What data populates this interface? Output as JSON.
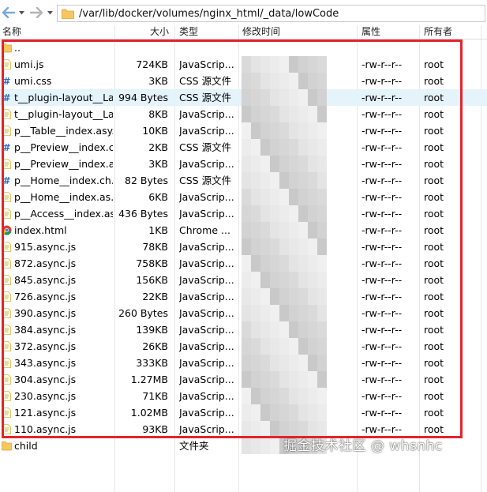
{
  "path_bar": {
    "path": "/var/lib/docker/volumes/nginx_html/_data/lowCode"
  },
  "columns": {
    "name": "名称",
    "size": "大小",
    "type": "类型",
    "modified": "修改时间",
    "perms": "属性",
    "owner": "所有者"
  },
  "files": [
    {
      "name": "..",
      "size": "",
      "type": "",
      "perms": "",
      "owner": "",
      "icon": "parent-folder-icon",
      "selected": false
    },
    {
      "name": "umi.js",
      "size": "724KB",
      "type": "JavaScrip...",
      "perms": "-rw-r--r--",
      "owner": "root",
      "icon": "js-file-icon",
      "selected": false
    },
    {
      "name": "umi.css",
      "size": "3KB",
      "type": "CSS 源文件",
      "perms": "-rw-r--r--",
      "owner": "root",
      "icon": "css-file-icon",
      "selected": false
    },
    {
      "name": "t__plugin-layout__La...",
      "size": "994 Bytes",
      "type": "CSS 源文件",
      "perms": "-rw-r--r--",
      "owner": "root",
      "icon": "css-file-icon",
      "selected": true
    },
    {
      "name": "t__plugin-layout__La...",
      "size": "8KB",
      "type": "JavaScrip...",
      "perms": "-rw-r--r--",
      "owner": "root",
      "icon": "js-file-icon",
      "selected": false
    },
    {
      "name": "p__Table__index.asy...",
      "size": "10KB",
      "type": "JavaScrip...",
      "perms": "-rw-r--r--",
      "owner": "root",
      "icon": "js-file-icon",
      "selected": false
    },
    {
      "name": "p__Preview__index.c...",
      "size": "2KB",
      "type": "CSS 源文件",
      "perms": "-rw-r--r--",
      "owner": "root",
      "icon": "css-file-icon",
      "selected": false
    },
    {
      "name": "p__Preview__index.a...",
      "size": "3KB",
      "type": "JavaScrip...",
      "perms": "-rw-r--r--",
      "owner": "root",
      "icon": "js-file-icon",
      "selected": false
    },
    {
      "name": "p__Home__index.ch...",
      "size": "82 Bytes",
      "type": "CSS 源文件",
      "perms": "-rw-r--r--",
      "owner": "root",
      "icon": "css-file-icon",
      "selected": false
    },
    {
      "name": "p__Home__index.as...",
      "size": "6KB",
      "type": "JavaScrip...",
      "perms": "-rw-r--r--",
      "owner": "root",
      "icon": "js-file-icon",
      "selected": false
    },
    {
      "name": "p__Access__index.as...",
      "size": "436 Bytes",
      "type": "JavaScrip...",
      "perms": "-rw-r--r--",
      "owner": "root",
      "icon": "js-file-icon",
      "selected": false
    },
    {
      "name": "index.html",
      "size": "1KB",
      "type": "Chrome ...",
      "perms": "-rw-r--r--",
      "owner": "root",
      "icon": "chrome-html-icon",
      "selected": false
    },
    {
      "name": "915.async.js",
      "size": "78KB",
      "type": "JavaScrip...",
      "perms": "-rw-r--r--",
      "owner": "root",
      "icon": "js-file-icon",
      "selected": false
    },
    {
      "name": "872.async.js",
      "size": "758KB",
      "type": "JavaScrip...",
      "perms": "-rw-r--r--",
      "owner": "root",
      "icon": "js-file-icon",
      "selected": false
    },
    {
      "name": "845.async.js",
      "size": "156KB",
      "type": "JavaScrip...",
      "perms": "-rw-r--r--",
      "owner": "root",
      "icon": "js-file-icon",
      "selected": false
    },
    {
      "name": "726.async.js",
      "size": "22KB",
      "type": "JavaScrip...",
      "perms": "-rw-r--r--",
      "owner": "root",
      "icon": "js-file-icon",
      "selected": false
    },
    {
      "name": "390.async.js",
      "size": "260 Bytes",
      "type": "JavaScrip...",
      "perms": "-rw-r--r--",
      "owner": "root",
      "icon": "js-file-icon",
      "selected": false
    },
    {
      "name": "384.async.js",
      "size": "139KB",
      "type": "JavaScrip...",
      "perms": "-rw-r--r--",
      "owner": "root",
      "icon": "js-file-icon",
      "selected": false
    },
    {
      "name": "372.async.js",
      "size": "26KB",
      "type": "JavaScrip...",
      "perms": "-rw-r--r--",
      "owner": "root",
      "icon": "js-file-icon",
      "selected": false
    },
    {
      "name": "343.async.js",
      "size": "333KB",
      "type": "JavaScrip...",
      "perms": "-rw-r--r--",
      "owner": "root",
      "icon": "js-file-icon",
      "selected": false
    },
    {
      "name": "304.async.js",
      "size": "1.27MB",
      "type": "JavaScrip...",
      "perms": "-rw-r--r--",
      "owner": "root",
      "icon": "js-file-icon",
      "selected": false
    },
    {
      "name": "230.async.js",
      "size": "71KB",
      "type": "JavaScrip...",
      "perms": "-rw-r--r--",
      "owner": "root",
      "icon": "js-file-icon",
      "selected": false
    },
    {
      "name": "121.async.js",
      "size": "1.02MB",
      "type": "JavaScrip...",
      "perms": "-rw-r--r--",
      "owner": "root",
      "icon": "js-file-icon",
      "selected": false
    },
    {
      "name": "110.async.js",
      "size": "93KB",
      "type": "JavaScrip...",
      "perms": "-rw-r--r--",
      "owner": "root",
      "icon": "js-file-icon",
      "selected": false
    },
    {
      "name": "child",
      "size": "",
      "type": "文件夹",
      "perms": "",
      "owner": "",
      "icon": "folder-icon",
      "selected": false
    }
  ],
  "highlight_color": "#e3242b",
  "selected_row_color": "#e5f3fb",
  "watermark": "掘金技术社区 @ whsnhc"
}
